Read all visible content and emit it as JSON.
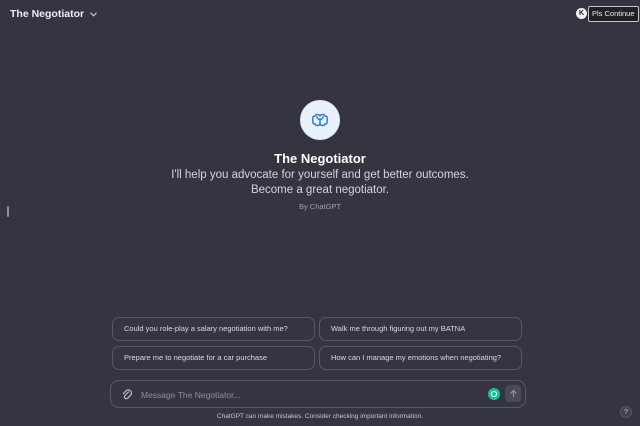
{
  "header": {
    "title": "The Negotiator",
    "user_initial": "K",
    "continue_label": "Pls Continue"
  },
  "hero": {
    "name": "The Negotiator",
    "description": "I'll help you advocate for yourself and get better outcomes. Become a great negotiator.",
    "by": "By ChatGPT",
    "logo_icon": "brain-sprout-icon",
    "logo_bg": "#e8f1fb",
    "logo_stroke": "#2f7fc6"
  },
  "starters": [
    "Could you role-play a salary negotiation with me?",
    "Walk me through figuring out my BATNA",
    "Prepare me to negotiate for a car purchase",
    "How can I manage my emotions when negotiating?"
  ],
  "composer": {
    "placeholder": "Message The Negotiator..."
  },
  "footer": {
    "disclaimer": "ChatGPT can make mistakes. Consider checking important information.",
    "help_label": "?"
  },
  "colors": {
    "background": "#343541",
    "border": "#565869",
    "grammarly": "#15c39a"
  }
}
